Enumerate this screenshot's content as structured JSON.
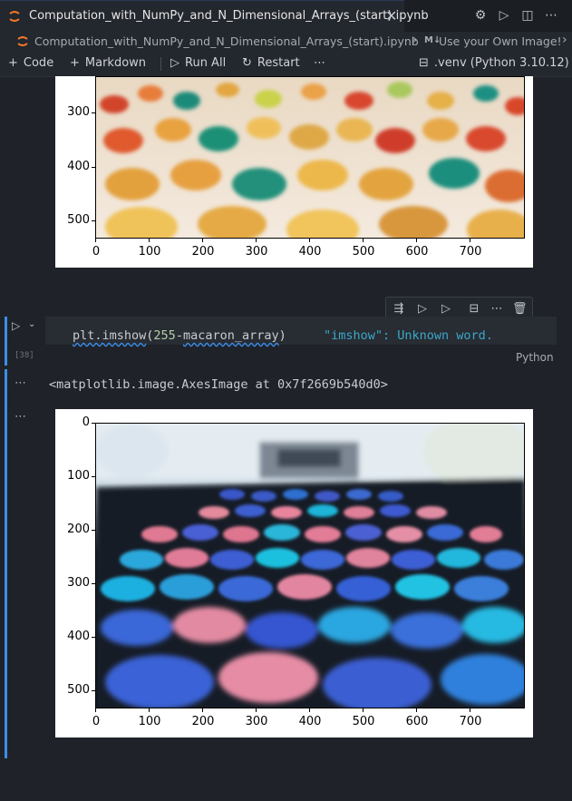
{
  "tab": {
    "title": "Computation_with_NumPy_and_N_Dimensional_Arrays_(start).ipynb",
    "close_icon": "close-icon"
  },
  "breadcrumb": {
    "file": "Computation_with_NumPy_and_N_Dimensional_Arrays_(start).ipynb",
    "md_badge": "M↓",
    "section": "Use your Own Image!"
  },
  "toolbar": {
    "code_label": "Code",
    "markdown_label": "Markdown",
    "run_all_label": "Run All",
    "restart_label": "Restart",
    "more_label": "⋯",
    "kernel_label": ".venv (Python 3.10.12)"
  },
  "figure1": {
    "yticks": [
      "300",
      "400",
      "500"
    ],
    "xticks": [
      "0",
      "100",
      "200",
      "300",
      "400",
      "500",
      "600",
      "700"
    ]
  },
  "cell": {
    "exec_count": "[38]",
    "code_fn": "plt.imshow",
    "code_paren_open": "(",
    "code_num": "255",
    "code_op": "-",
    "code_var": "macaron_array",
    "code_paren_close": ")",
    "diagnostic": "\"imshow\": Unknown word.",
    "language": "Python"
  },
  "output": {
    "ellipsis": "⋯",
    "text": "<matplotlib.image.AxesImage at 0x7f2669b540d0>"
  },
  "figure2": {
    "yticks": [
      "0",
      "100",
      "200",
      "300",
      "400",
      "500"
    ],
    "xticks": [
      "0",
      "100",
      "200",
      "300",
      "400",
      "500",
      "600",
      "700"
    ]
  }
}
